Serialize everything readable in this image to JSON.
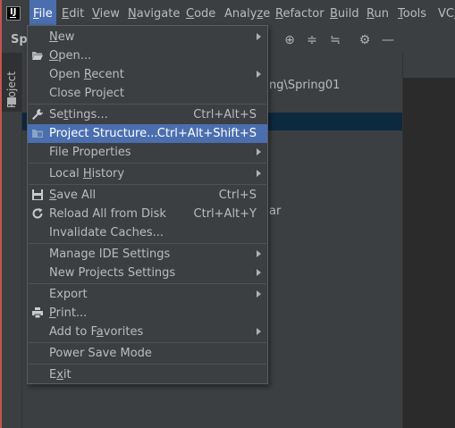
{
  "menubar": {
    "items": [
      {
        "label": "File",
        "u": "F",
        "rest": "ile"
      },
      {
        "label": "Edit",
        "u": "E",
        "rest": "dit"
      },
      {
        "label": "View",
        "u": "V",
        "rest": "iew"
      },
      {
        "label": "Navigate",
        "u": "N",
        "rest": "avigate"
      },
      {
        "label": "Code",
        "u": "C",
        "rest": "ode"
      },
      {
        "label": "Analyze",
        "pre": "Analy",
        "u": "z",
        "rest": "e"
      },
      {
        "label": "Refactor",
        "u": "R",
        "rest": "efactor"
      },
      {
        "label": "Build",
        "u": "B",
        "rest": "uild"
      },
      {
        "label": "Run",
        "u": "R",
        "rest": "un"
      },
      {
        "label": "Tools",
        "u": "T",
        "rest": "ools"
      },
      {
        "label": "VCS",
        "pre": "VC",
        "u": "S",
        "rest": ""
      }
    ]
  },
  "toolbar": {
    "title": "Spr"
  },
  "sidebar": {
    "project_tab": "Project"
  },
  "panel": {
    "path_fragment": "ng\\Spring01",
    "row_fragment": "ar"
  },
  "file_menu": {
    "new": "New",
    "open": "Open...",
    "open_recent": "Open Recent",
    "close_project": "Close Project",
    "settings": {
      "label": "Settings...",
      "shortcut": "Ctrl+Alt+S"
    },
    "project_structure": {
      "label": "Project Structure...",
      "shortcut": "Ctrl+Alt+Shift+S"
    },
    "file_properties": "File Properties",
    "local_history": "Local History",
    "save_all": {
      "label": "Save All",
      "shortcut": "Ctrl+S"
    },
    "reload": {
      "label": "Reload All from Disk",
      "shortcut": "Ctrl+Alt+Y"
    },
    "invalidate_caches": "Invalidate Caches...",
    "manage_ide_settings": "Manage IDE Settings",
    "new_projects_settings": "New Projects Settings",
    "export": "Export",
    "print": "Print...",
    "add_to_favorites": "Add to Favorites",
    "power_save_mode": "Power Save Mode",
    "exit": "Exit"
  },
  "colors": {
    "menu_bg": "#3c3f41",
    "highlight": "#4b6eaf",
    "editor_bg": "#2b2b2b",
    "text": "#bbbbbb"
  }
}
